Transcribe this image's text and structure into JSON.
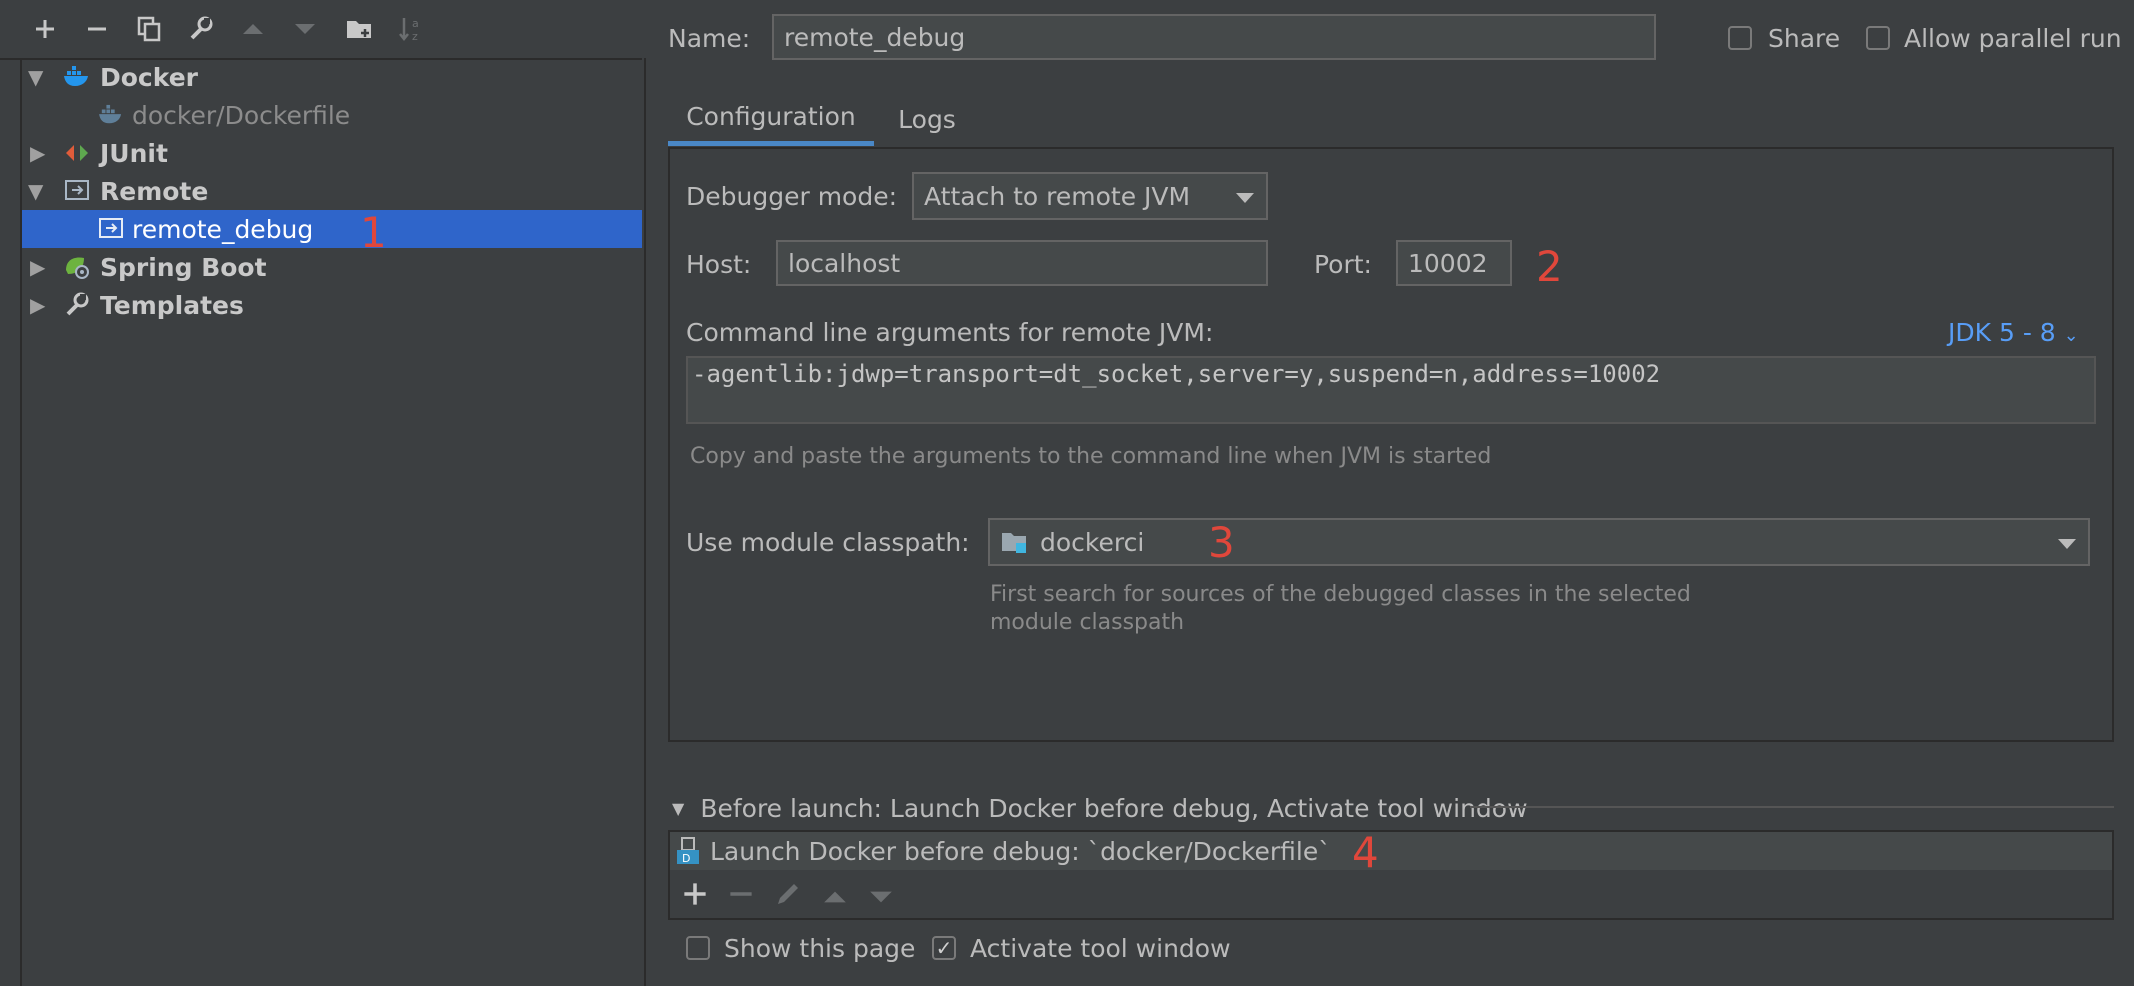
{
  "toolbar": {
    "add": "+",
    "remove": "−",
    "icons": [
      "plus-icon",
      "minus-icon",
      "copy-icon",
      "wrench-icon",
      "arrow-up-icon",
      "arrow-down-icon",
      "new-folder-icon",
      "sort-icon"
    ]
  },
  "tree": {
    "items": [
      {
        "label": "Docker"
      },
      {
        "label": "docker/Dockerfile"
      },
      {
        "label": "JUnit"
      },
      {
        "label": "Remote"
      },
      {
        "label": "remote_debug"
      },
      {
        "label": "Spring Boot"
      },
      {
        "label": "Templates"
      }
    ]
  },
  "annotations": {
    "n1": "1",
    "n2": "2",
    "n3": "3",
    "n4": "4"
  },
  "header": {
    "name_label": "Name:",
    "name_value": "remote_debug",
    "share_label": "Share",
    "parallel_label": "Allow parallel run"
  },
  "tabs": [
    {
      "label": "Configuration"
    },
    {
      "label": "Logs"
    }
  ],
  "config": {
    "debugger_label": "Debugger mode:",
    "debugger_value": "Attach to remote JVM",
    "host_label": "Host:",
    "host_value": "localhost",
    "port_label": "Port:",
    "port_value": "10002",
    "cmd_label": "Command line arguments for remote JVM:",
    "jdk_link": "JDK 5 - 8",
    "cmd_value": "-agentlib:jdwp=transport=dt_socket,server=y,suspend=n,address=10002",
    "cmd_help": "Copy and paste the arguments to the command line when JVM is started",
    "module_label": "Use module classpath:",
    "module_value": "dockerci",
    "module_help_1": "First search for sources of the debugged classes in the selected",
    "module_help_2": "module classpath"
  },
  "before_launch": {
    "title": "Before launch: Launch Docker before debug, Activate tool window",
    "task": "Launch Docker before debug: `docker/Dockerfile`",
    "show_page_label": "Show this page",
    "show_page_checked": false,
    "activate_label": "Activate tool window",
    "activate_checked": true
  },
  "colors": {
    "accent": "#2f65ca",
    "link": "#589df6",
    "annotation": "#e0473b"
  }
}
